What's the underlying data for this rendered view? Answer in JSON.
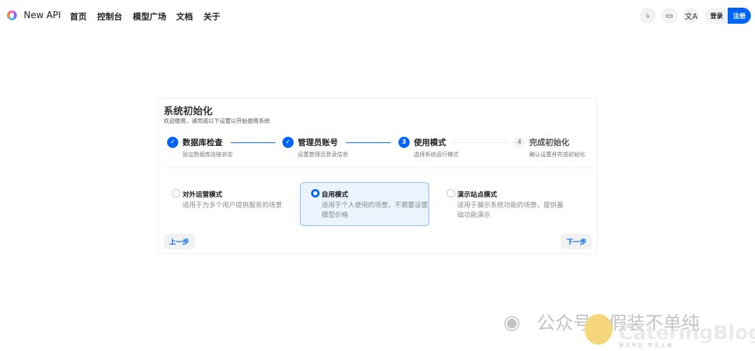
{
  "header": {
    "brand": "New API",
    "menu": [
      "首页",
      "控制台",
      "模型广场",
      "文档",
      "关于"
    ],
    "icons": [
      "bell-icon",
      "monitor-icon",
      "translate-icon"
    ],
    "login": "登录",
    "register": "注册",
    "accent": "#0064fa"
  },
  "card": {
    "title": "系统初始化",
    "subtitle": "欢迎使用，请完成以下设置以开始使用系统",
    "steps": [
      {
        "label": "数据库检查",
        "desc": "验证数据库连接状态",
        "status": "done"
      },
      {
        "label": "管理员账号",
        "desc": "设置管理员登录信息",
        "status": "done"
      },
      {
        "label": "使用模式",
        "num": "3",
        "desc": "选择系统运行模式",
        "status": "current"
      },
      {
        "label": "完成初始化",
        "num": "4",
        "desc": "确认设置并完成初始化",
        "status": "wait"
      }
    ],
    "options": [
      {
        "label": "对外运营模式",
        "desc": "适用于为多个用户提供服务的场景",
        "selected": false
      },
      {
        "label": "自用模式",
        "desc": "适用于个人使用的场景，不需要设置模型价格",
        "selected": true
      },
      {
        "label": "演示站点模式",
        "desc": "适用于展示系统功能的场景，提供基础功能演示",
        "selected": false
      }
    ],
    "prev": "上一步",
    "next": "下一步"
  },
  "watermark": {
    "text": "公众号 · 假装不单纯",
    "blog": "CateringBlog",
    "motto": "理 无 专 在   学 无 止 境"
  }
}
